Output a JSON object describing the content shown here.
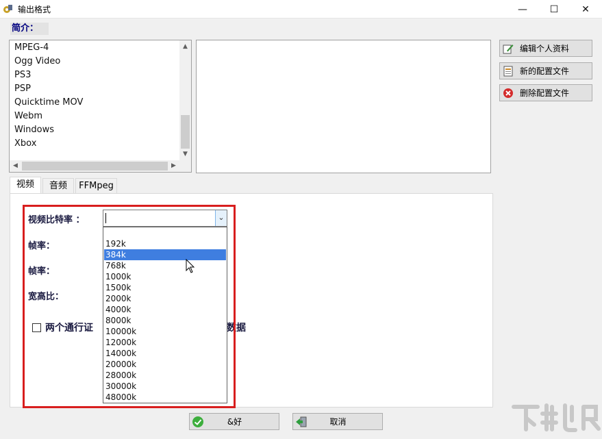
{
  "window": {
    "title": "输出格式",
    "controls": {
      "minimize": "—",
      "maximize": "☐",
      "close": "✕"
    }
  },
  "intro_label": "简介：",
  "profiles": {
    "items": [
      "MPEG-4",
      "Ogg Video",
      "PS3",
      "PSP",
      "Quicktime MOV",
      "Webm",
      "Windows",
      "Xbox"
    ]
  },
  "side_buttons": {
    "edit_profile": "编辑个人资料",
    "new_profile": "新的配置文件",
    "delete_profile": "删除配置文件"
  },
  "tabs": [
    "视频",
    "音频",
    "FFMpeg"
  ],
  "active_tab": 0,
  "video_tab": {
    "bitrate_label": "视频比特率 ：",
    "bitrate_value": "",
    "framerate_label_1": "帧率：",
    "framerate_label_2": "帧率：",
    "aspect_label": "宽高比：",
    "two_pass_label": "两个通行证",
    "trailing_text": "数据",
    "bitrate_options": [
      "",
      "192k",
      "384k",
      "768k",
      "1000k",
      "1500k",
      "2000k",
      "4000k",
      "8000k",
      "10000k",
      "12000k",
      "14000k",
      "20000k",
      "28000k",
      "30000k",
      "48000k"
    ],
    "selected_option": "384k"
  },
  "bottom_buttons": {
    "ok": "&好",
    "cancel": "取消"
  },
  "colors": {
    "highlight": "#d81e1e",
    "selection": "#3f7ee0",
    "label_navy": "#000080"
  }
}
